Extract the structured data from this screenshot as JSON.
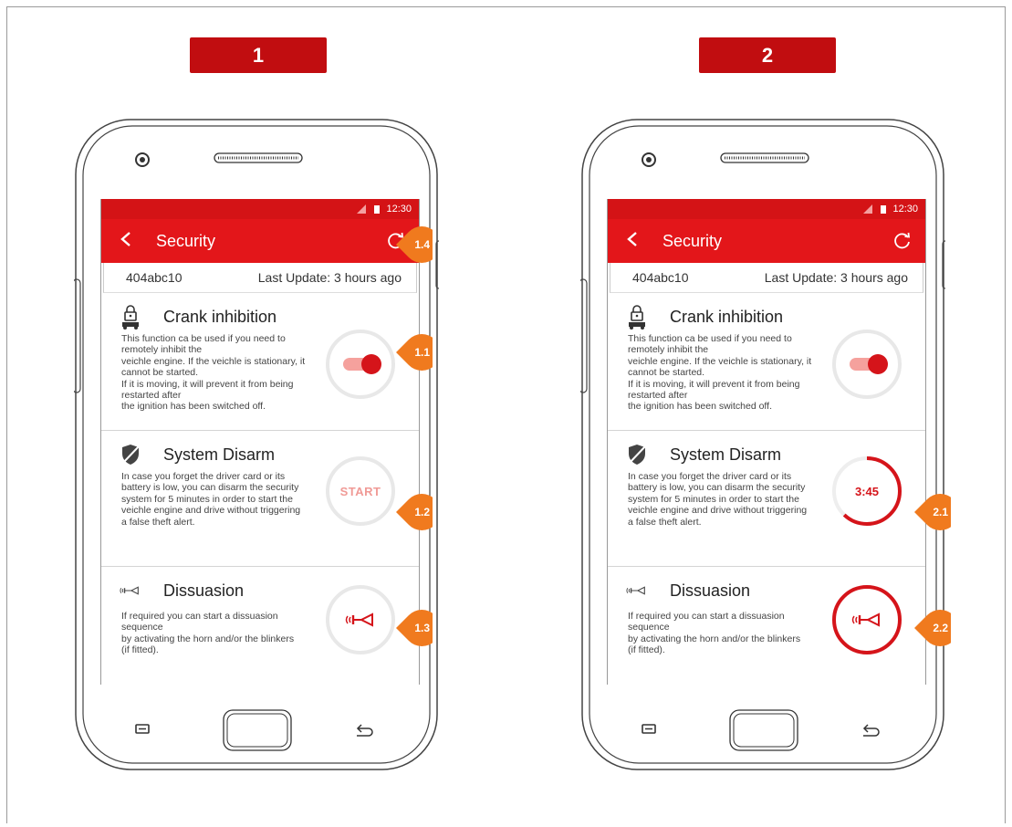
{
  "steps": [
    {
      "label": "1"
    },
    {
      "label": "2"
    }
  ],
  "phones": [
    {
      "status_time": "12:30",
      "title": "Security",
      "vehicle_id": "404abc10",
      "last_update": "Last Update: 3 hours ago",
      "sections": {
        "crank": {
          "title": "Crank inhibition",
          "icon": "lock-car-icon",
          "desc": [
            "This function ca be used if you need to",
            "remotely inhibit the",
            "veichle engine. If the veichle is stationary, it",
            "cannot be started.",
            "If it is moving, it will prevent it from being",
            "restarted after",
            "the ignition has been switched off."
          ]
        },
        "disarm": {
          "title": "System Disarm",
          "icon": "shield-off-icon",
          "desc": [
            "In case you forget the driver card or its",
            "battery is low, you can disarm the security",
            "system for 5 minutes in order to start the",
            "veichle engine and drive without triggering",
            "a false theft alert."
          ],
          "button_label": "START"
        },
        "dissuasion": {
          "title": "Dissuasion",
          "icon": "horn-icon",
          "desc": [
            "If required you can start a dissuasion",
            "sequence",
            "by activating the horn and/or the blinkers",
            "(if fitted)."
          ]
        }
      },
      "callouts": [
        "1.4",
        "1.1",
        "1.2",
        "1.3"
      ]
    },
    {
      "status_time": "12:30",
      "title": "Security",
      "vehicle_id": "404abc10",
      "last_update": "Last Update: 3 hours ago",
      "sections": {
        "crank": {
          "title": "Crank inhibition",
          "icon": "lock-car-icon",
          "desc": [
            "This function ca be used if you need to",
            "remotely inhibit the",
            "veichle engine. If the veichle is stationary, it",
            "cannot be started.",
            "If it is moving, it will prevent it from being",
            "restarted after",
            "the ignition has been switched off."
          ]
        },
        "disarm": {
          "title": "System Disarm",
          "icon": "shield-off-icon",
          "desc": [
            "In case you forget the driver card or its",
            "battery is low, you can disarm the security",
            "system for 5 minutes in order to start the",
            "veichle engine and drive without triggering",
            "a false theft alert."
          ],
          "timer": "3:45",
          "timer_progress": 0.62
        },
        "dissuasion": {
          "title": "Dissuasion",
          "icon": "horn-icon",
          "desc": [
            "If required you can start a dissuasion",
            "sequence",
            "by activating the horn and/or the blinkers",
            "(if fitted)."
          ]
        }
      },
      "callouts": [
        "2.1",
        "2.2"
      ]
    }
  ],
  "colors": {
    "brand_red": "#e3161a",
    "dark_red": "#c10d10",
    "callout_orange": "#f07a1e"
  }
}
